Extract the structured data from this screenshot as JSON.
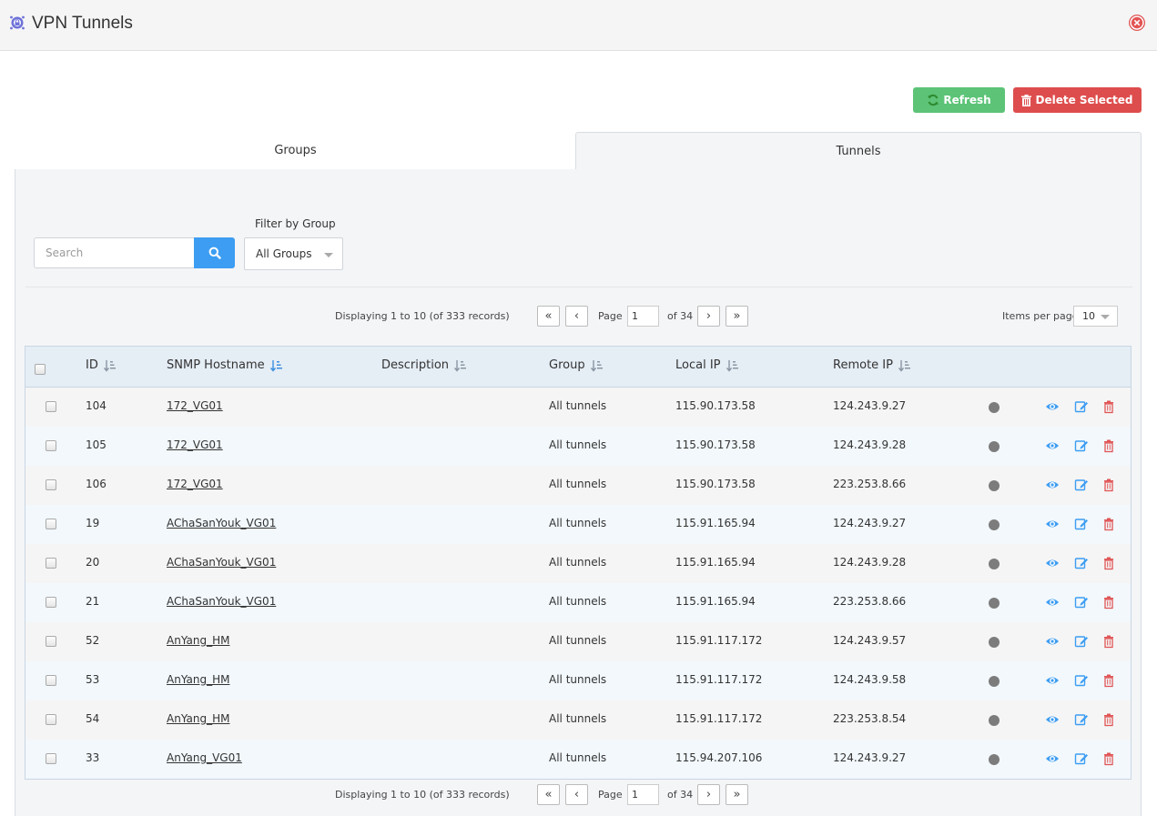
{
  "window": {
    "title": "VPN Tunnels"
  },
  "toolbar": {
    "refresh_label": "Refresh",
    "delete_label": "Delete Selected"
  },
  "tabs": [
    {
      "label": "Groups"
    },
    {
      "label": "Tunnels"
    }
  ],
  "search": {
    "placeholder": "Search",
    "value": ""
  },
  "filter": {
    "label": "Filter by Group",
    "selected": "All Groups"
  },
  "pager": {
    "displaying": "Displaying 1 to 10 (of 333 records)",
    "page_label": "Page",
    "page_value": "1",
    "of_label": "of 34",
    "items_per_page_label": "Items per page",
    "items_per_page": "10"
  },
  "table": {
    "columns": [
      "ID",
      "SNMP Hostname",
      "Description",
      "Group",
      "Local IP",
      "Remote IP"
    ],
    "rows": [
      {
        "id": "104",
        "hostname": "172_VG01",
        "description": "",
        "group": "All tunnels",
        "local_ip": "115.90.173.58",
        "remote_ip": "124.243.9.27"
      },
      {
        "id": "105",
        "hostname": "172_VG01",
        "description": "",
        "group": "All tunnels",
        "local_ip": "115.90.173.58",
        "remote_ip": "124.243.9.28"
      },
      {
        "id": "106",
        "hostname": "172_VG01",
        "description": "",
        "group": "All tunnels",
        "local_ip": "115.90.173.58",
        "remote_ip": "223.253.8.66"
      },
      {
        "id": "19",
        "hostname": "AChaSanYouk_VG01",
        "description": "",
        "group": "All tunnels",
        "local_ip": "115.91.165.94",
        "remote_ip": "124.243.9.27"
      },
      {
        "id": "20",
        "hostname": "AChaSanYouk_VG01",
        "description": "",
        "group": "All tunnels",
        "local_ip": "115.91.165.94",
        "remote_ip": "124.243.9.28"
      },
      {
        "id": "21",
        "hostname": "AChaSanYouk_VG01",
        "description": "",
        "group": "All tunnels",
        "local_ip": "115.91.165.94",
        "remote_ip": "223.253.8.66"
      },
      {
        "id": "52",
        "hostname": "AnYang_HM",
        "description": "",
        "group": "All tunnels",
        "local_ip": "115.91.117.172",
        "remote_ip": "124.243.9.57"
      },
      {
        "id": "53",
        "hostname": "AnYang_HM",
        "description": "",
        "group": "All tunnels",
        "local_ip": "115.91.117.172",
        "remote_ip": "124.243.9.58"
      },
      {
        "id": "54",
        "hostname": "AnYang_HM",
        "description": "",
        "group": "All tunnels",
        "local_ip": "115.91.117.172",
        "remote_ip": "223.253.8.54"
      },
      {
        "id": "33",
        "hostname": "AnYang_VG01",
        "description": "",
        "group": "All tunnels",
        "local_ip": "115.94.207.106",
        "remote_ip": "124.243.9.27"
      }
    ]
  },
  "colors": {
    "refresh": "#5cc377",
    "delete": "#de4d4d",
    "search_button": "#3d9df2",
    "status_dot": "#7c7c7c",
    "view_icon": "#3d9df2",
    "edit_icon": "#3d9df2",
    "trash_icon": "#e05555"
  }
}
